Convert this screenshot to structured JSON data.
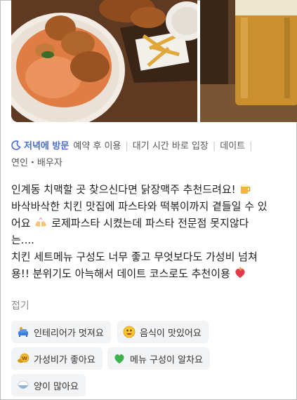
{
  "visit": {
    "icon": "moon-icon",
    "label": "저녁에 방문",
    "tags": [
      "예약 후 이용",
      "대기 시간 바로 입장",
      "데이트",
      "연인・배우자"
    ],
    "accent_color": "#4a6bd1"
  },
  "review": {
    "line1": "인계동 치맥할 곳 찾으신다면 닭장맥주 추천드려요!",
    "line2": "바삭바삭한 치킨 맛집에 파스타와 떡볶이까지 곁들일 수 있",
    "line3": "어요",
    "line3b": "로제파스타 시켰는데 파스타 전문점 못지않다",
    "line4": "는....",
    "line5": "치킨 세트메뉴 구성도 너무 좋고 무엇보다도 가성비 넘쳐",
    "line6": "용!! 분위기도 아늑해서 데이트 코스로도 추천이용",
    "emoji1": "beer-icon",
    "emoji2": "praising-hands-icon",
    "emoji3": "heart-on-fire-icon"
  },
  "fold_label": "접기",
  "keywords": [
    {
      "icon": "sofa-icon",
      "label": "인테리어가 멋져요"
    },
    {
      "icon": "yum-face-icon",
      "label": "음식이 맛있어요"
    },
    {
      "icon": "coin-icon",
      "label": "가성비가 좋아요"
    },
    {
      "icon": "green-heart-icon",
      "label": "메뉴 구성이 알차요"
    },
    {
      "icon": "rice-bowl-icon",
      "label": "양이 많아요"
    }
  ]
}
